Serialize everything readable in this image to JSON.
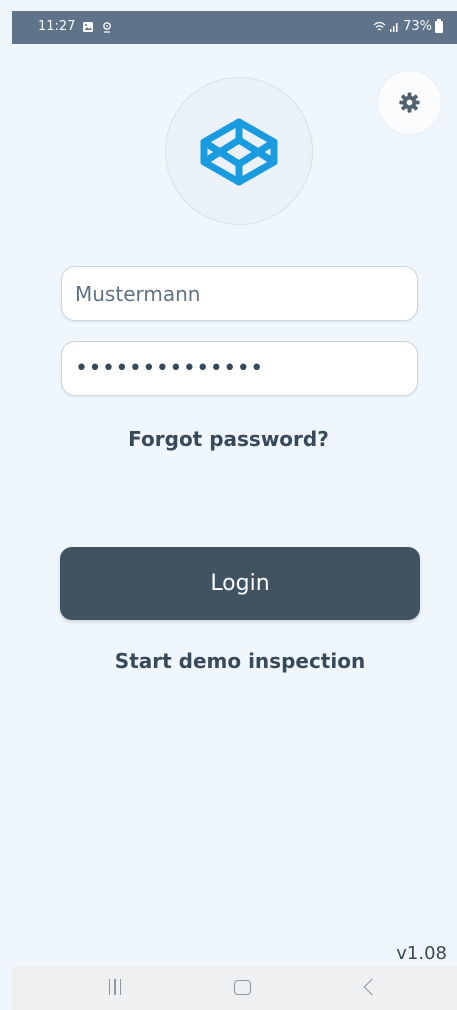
{
  "status": {
    "time": "11:27",
    "battery": "73%",
    "left_icons": [
      "image-icon",
      "location-icon"
    ],
    "right_icons": [
      "wifi-icon",
      "signal-icon",
      "battery-icon"
    ]
  },
  "login": {
    "logo_icon": "codepen-cube-logo",
    "settings_icon": "gear-icon",
    "username_value": "Mustermann",
    "password_masked": "••••••••••••••",
    "forgot_password": "Forgot password?",
    "login_button": "Login",
    "demo_link": "Start demo inspection",
    "version": "v1.08"
  },
  "colors": {
    "background": "#eff7fd",
    "primary_button": "#3f5360",
    "accent_logo": "#1a9be0",
    "text": "#37495a"
  },
  "navigation": {
    "icons": [
      "recent-apps-icon",
      "home-icon",
      "back-icon"
    ]
  }
}
